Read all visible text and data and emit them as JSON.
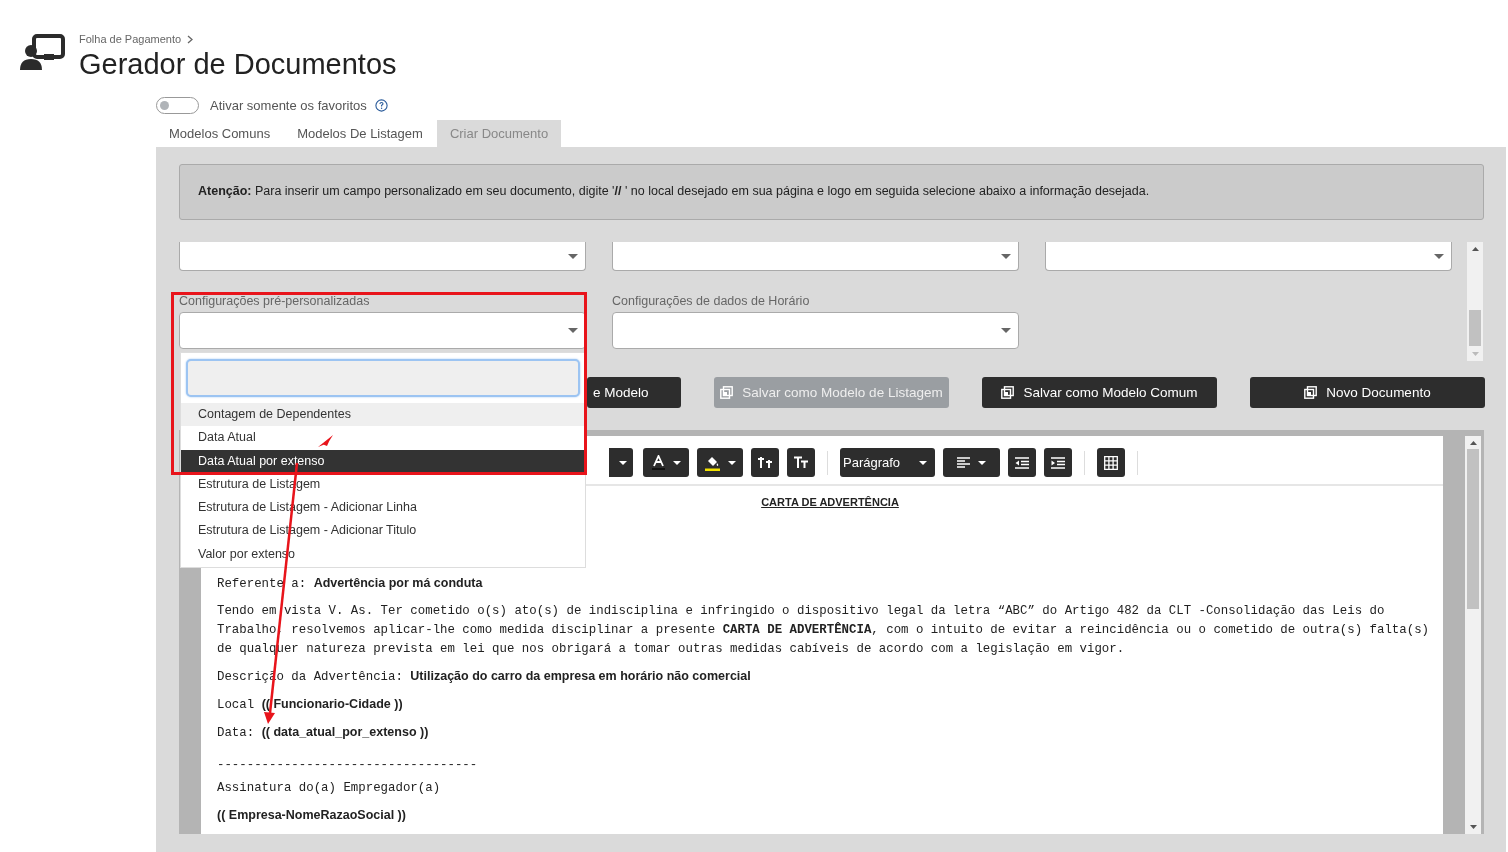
{
  "breadcrumb": "Folha de Pagamento",
  "title": "Gerador de Documentos",
  "favorites_toggle": {
    "label": "Ativar somente os favoritos",
    "on": false
  },
  "tabs": [
    {
      "label": "Modelos Comuns",
      "selected": false
    },
    {
      "label": "Modelos De Listagem",
      "selected": false
    },
    {
      "label": "Criar Documento",
      "selected": true
    }
  ],
  "notice": "**Atenção:** Para inserir um campo personalizado em seu documento, digite '**//** ' no local desejado em sua página e logo em seguida selecione abaixo a informação desejada.",
  "fields": [
    {
      "label": "Configurações pré-personalizadas"
    },
    {
      "label": "Configurações de dados de Horário"
    }
  ],
  "dropdown": {
    "options": [
      {
        "label": "Contagem de Dependentes",
        "highlighted": true,
        "selected": false
      },
      {
        "label": "Data Atual",
        "highlighted": false,
        "selected": false
      },
      {
        "label": "Data Atual por extenso",
        "highlighted": false,
        "selected": true
      },
      {
        "label": "Estrutura de Listagem",
        "highlighted": false,
        "selected": false
      },
      {
        "label": "Estrutura de Listagem - Adicionar Linha",
        "highlighted": false,
        "selected": false
      },
      {
        "label": "Estrutura de Listagem - Adicionar Titulo",
        "highlighted": false,
        "selected": false
      },
      {
        "label": "Valor por extenso",
        "highlighted": false,
        "selected": false
      }
    ]
  },
  "buttons": [
    {
      "label": "e Modelo",
      "icon": false,
      "disabled": false
    },
    {
      "label": "Salvar como Modelo de Listagem",
      "icon": true,
      "disabled": true
    },
    {
      "label": "Salvar como Modelo Comum",
      "icon": true,
      "disabled": false
    },
    {
      "label": "Novo Documento",
      "icon": true,
      "disabled": false
    }
  ],
  "toolbar": {
    "style_select": "Parágrafo"
  },
  "document": {
    "heading": "CARTA DE ADVERTÊNCIA",
    "paragraphs": [
      {
        "kind": "field",
        "text": "Referente a: **Advertência por má conduta**"
      },
      {
        "kind": "text",
        "text": "Tendo em vista V. As. Ter cometido o(s) ato(s) de indisciplina e infringido o dispositivo legal da letra “ABC” do Artigo 482 da CLT  -Consolidação das Leis do Trabalho, resolvemos aplicar-lhe como medida disciplinar a presente **CARTA DE ADVERTÊNCIA**, com o intuito de evitar a reincidência ou o cometido de outra(s) falta(s) de qualquer natureza prevista em lei que nos obrigará a tomar outras medidas cabíveis de acordo com a legislação em vigor."
      },
      {
        "kind": "field",
        "text": "Descrição da Advertência:  **Utilização do carro da empresa em horário não comercial**"
      },
      {
        "kind": "field",
        "text": "Local  **(( Funcionario-Cidade ))**"
      },
      {
        "kind": "field",
        "text": "Data: **(( data_atual_por_extenso ))**"
      },
      {
        "kind": "rule",
        "text": "-----------------------------------"
      },
      {
        "kind": "text",
        "text": "Assinatura do(a) Empregador(a)"
      },
      {
        "kind": "field",
        "text": "**(( Empresa-NomeRazaoSocial ))**"
      }
    ]
  },
  "annotations": [
    {
      "kind": "frame"
    },
    {
      "kind": "arrow"
    },
    {
      "kind": "arrowhead"
    }
  ]
}
